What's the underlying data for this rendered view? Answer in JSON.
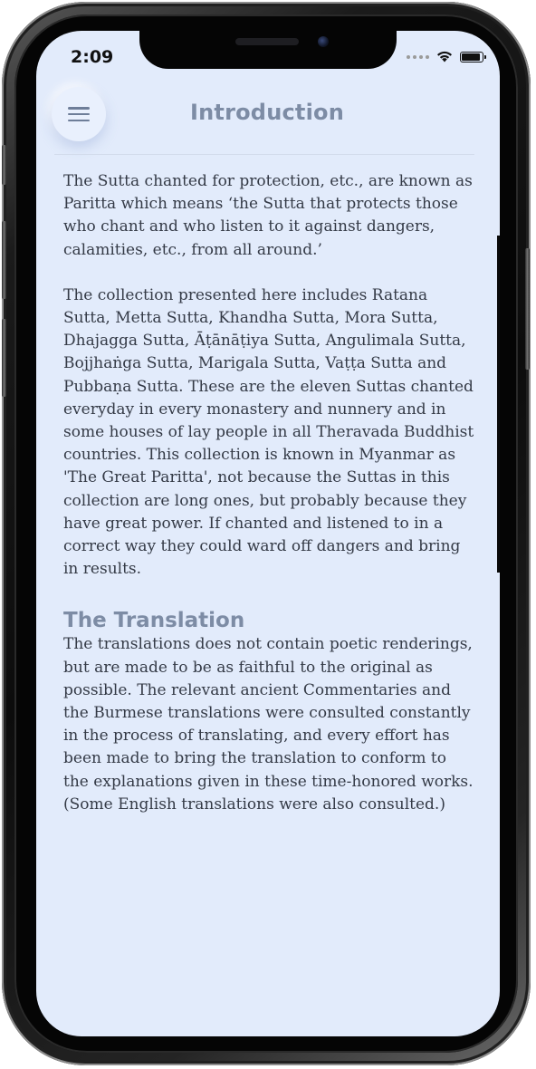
{
  "status_bar": {
    "time": "2:09",
    "wifi_icon": "wifi-icon",
    "battery_icon": "battery-icon",
    "battery_level": 0.9
  },
  "header": {
    "menu_icon": "menu-icon",
    "title": "Introduction"
  },
  "content": {
    "paragraphs": [
      "The Sutta chanted for protection, etc., are known as Paritta which means ‘the Sutta that protects those who chant and who listen to it against dangers, calamities, etc., from all around.’",
      "The collection presented here includes Ratana Sutta, Metta Sutta, Khandha Sutta, Mora Sutta, Dhajagga Sutta, Āṭānāṭiya Sutta, Angulimala Sutta, Bojjhaṅga Sutta, Marigala Sutta, Vaṭṭa Sutta and Pubbaṇa Sutta. These are the eleven Suttas chanted everyday in every monastery and nunnery and in some houses of lay people in all Theravada Buddhist countries. This collection is known in Myanmar as 'The Great Paritta', not because the Suttas in this collection are long ones, but probably because they have great power. If chanted and listened to in a correct way they could ward off dangers and bring in results."
    ],
    "section": {
      "heading": "The Translation",
      "body": "The translations does not contain poetic renderings, but are made to be as faithful to the original as possible. The relevant ancient Commentaries and the Burmese translations were consulted constantly in the process of translating, and every effort has been made to bring the translation to conform to the explanations given in these time-honored works. (Some English translations were also consulted.)"
    }
  },
  "colors": {
    "screen_background": "#e2ebfb",
    "title_color": "#7d8ca5",
    "body_text": "#343a46"
  }
}
